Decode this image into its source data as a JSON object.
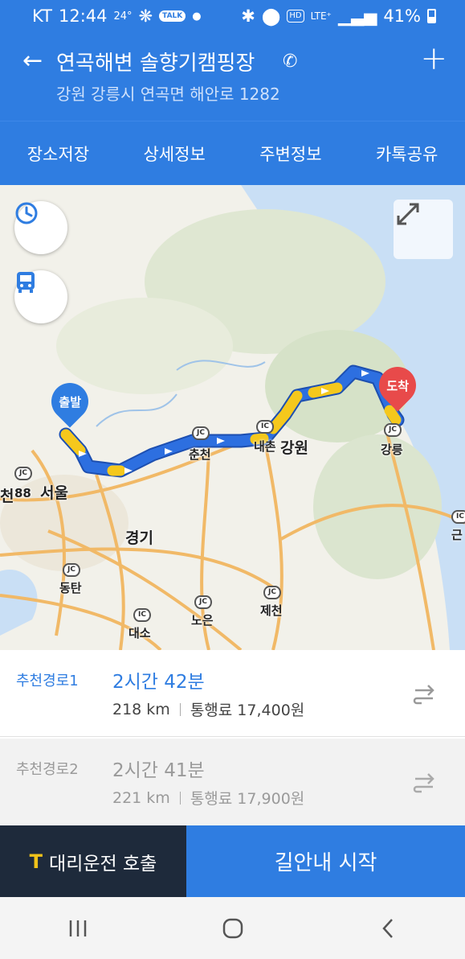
{
  "status_bar": {
    "carrier": "KT",
    "time": "12:44",
    "temperature": "24°",
    "talk_badge": "TALK",
    "hd": "HD",
    "network": "LTE⁺",
    "battery": "41%"
  },
  "header": {
    "title": "연곡해변 솔향기캠핑장",
    "address": "강원 강릉시 연곡면 해안로 1282"
  },
  "tabs": [
    "장소저장",
    "상세정보",
    "주변정보",
    "카톡공유"
  ],
  "map": {
    "start_pin": "출발",
    "end_pin": "도착",
    "route_color": "#2d6fe0",
    "traffic_color": "#f5c81c",
    "jc_label": "JC",
    "ic_label": "IC",
    "labels": {
      "seoul": "서울",
      "cheon": "천",
      "route88": "88",
      "gyeonggi": "경기",
      "chuncheon": "춘천",
      "naechon": "내촌",
      "gangwon": "강원",
      "gangneung": "강릉",
      "dongtan": "동탄",
      "daeso": "대소",
      "noeun": "노은",
      "jecheon": "제천",
      "geun": "근"
    }
  },
  "routes": [
    {
      "name": "추천경로1",
      "time": "2시간 42분",
      "distance": "218 km",
      "toll": "통행료 17,400원"
    },
    {
      "name": "추천경로2",
      "time": "2시간 41분",
      "distance": "221 km",
      "toll": "통행료 17,900원"
    }
  ],
  "bottom": {
    "driver_logo": "T",
    "driver_label": "대리운전 호출",
    "start_label": "길안내 시작"
  },
  "icons": {
    "history": "clock-icon",
    "transit": "bus-icon",
    "expand": "expand-icon",
    "route_option": "route-switch-icon"
  },
  "colors": {
    "primary": "#2f7de1",
    "dark": "#1e2a3b",
    "pin_start": "#2f7de1",
    "pin_end": "#e84a4a"
  }
}
